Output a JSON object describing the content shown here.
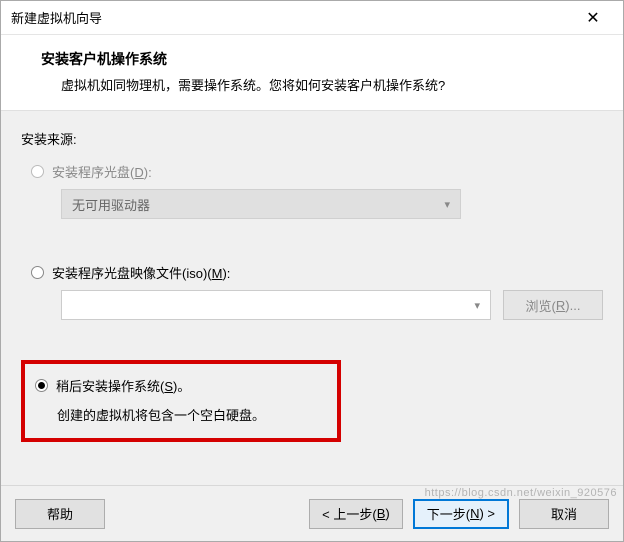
{
  "window": {
    "title": "新建虚拟机向导",
    "close": "✕"
  },
  "header": {
    "title": "安装客户机操作系统",
    "subtitle": "虚拟机如同物理机，需要操作系统。您将如何安装客户机操作系统?"
  },
  "sourceLabel": "安装来源:",
  "opt1": {
    "labelPrefix": "安装程序光盘(",
    "hotkey": "D",
    "labelSuffix": "):",
    "dropdownText": "无可用驱动器"
  },
  "opt2": {
    "labelPrefix": "安装程序光盘映像文件(iso)(",
    "hotkey": "M",
    "labelSuffix": "):",
    "browsePrefix": "浏览(",
    "browseHotkey": "R",
    "browseSuffix": ")..."
  },
  "opt3": {
    "labelPrefix": "稍后安装操作系统(",
    "hotkey": "S",
    "labelSuffix": ")。",
    "desc": "创建的虚拟机将包含一个空白硬盘。"
  },
  "footer": {
    "help": "帮助",
    "backPrefix": "< 上一步(",
    "backHotkey": "B",
    "backSuffix": ")",
    "nextPrefix": "下一步(",
    "nextHotkey": "N",
    "nextSuffix": ") >",
    "cancel": "取消"
  },
  "watermark": "https://blog.csdn.net/weixin_920576"
}
